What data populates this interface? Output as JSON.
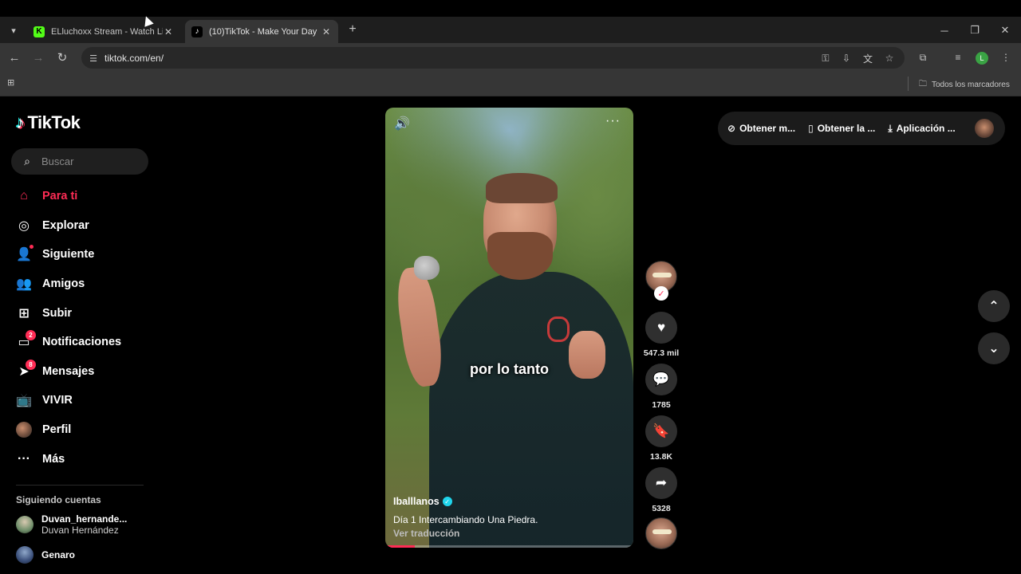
{
  "browser": {
    "tabs": [
      {
        "title": "ELluchoxx Stream - Watch Live",
        "favicon": "kick-icon",
        "active": false
      },
      {
        "title": "(10)TikTok - Make Your Day",
        "favicon": "tiktok-icon",
        "active": true
      }
    ],
    "url": "tiktok.com/en/",
    "bookmarks_all": "Todos los marcadores",
    "profile_initial": "L"
  },
  "tiktok": {
    "logo": "TikTok",
    "search_placeholder": "Buscar",
    "nav": [
      {
        "label": "Para ti",
        "icon": "home-icon",
        "active": true
      },
      {
        "label": "Explorar",
        "icon": "compass-icon"
      },
      {
        "label": "Siguiente",
        "icon": "following-icon"
      },
      {
        "label": "Amigos",
        "icon": "friends-icon"
      },
      {
        "label": "Subir",
        "icon": "upload-icon"
      },
      {
        "label": "Notificaciones",
        "icon": "inbox-icon",
        "badge": "2"
      },
      {
        "label": "Mensajes",
        "icon": "messages-icon",
        "badge": "8"
      },
      {
        "label": "VIVIR",
        "icon": "live-icon"
      },
      {
        "label": "Perfil",
        "icon": "avatar"
      },
      {
        "label": "Más",
        "icon": "more-icon"
      }
    ],
    "following_title": "Siguiendo cuentas",
    "following": [
      {
        "username": "Duvan_hernande...",
        "name": "Duvan Hernández"
      },
      {
        "username": "Genaro",
        "name": ""
      }
    ],
    "topbar": {
      "coins": "Obtener m...",
      "get_app": "Obtener la ...",
      "desktop_app": "Aplicación ..."
    },
    "video": {
      "caption_overlay": "por lo tanto",
      "username": "Iballlanos",
      "description": "Día 1 Intercambiando Una Piedra.",
      "translate": "Ver traducción",
      "progress": 0.12
    },
    "actions": {
      "likes": "547.3 mil",
      "comments": "1785",
      "saves": "13.8K",
      "shares": "5328"
    }
  }
}
